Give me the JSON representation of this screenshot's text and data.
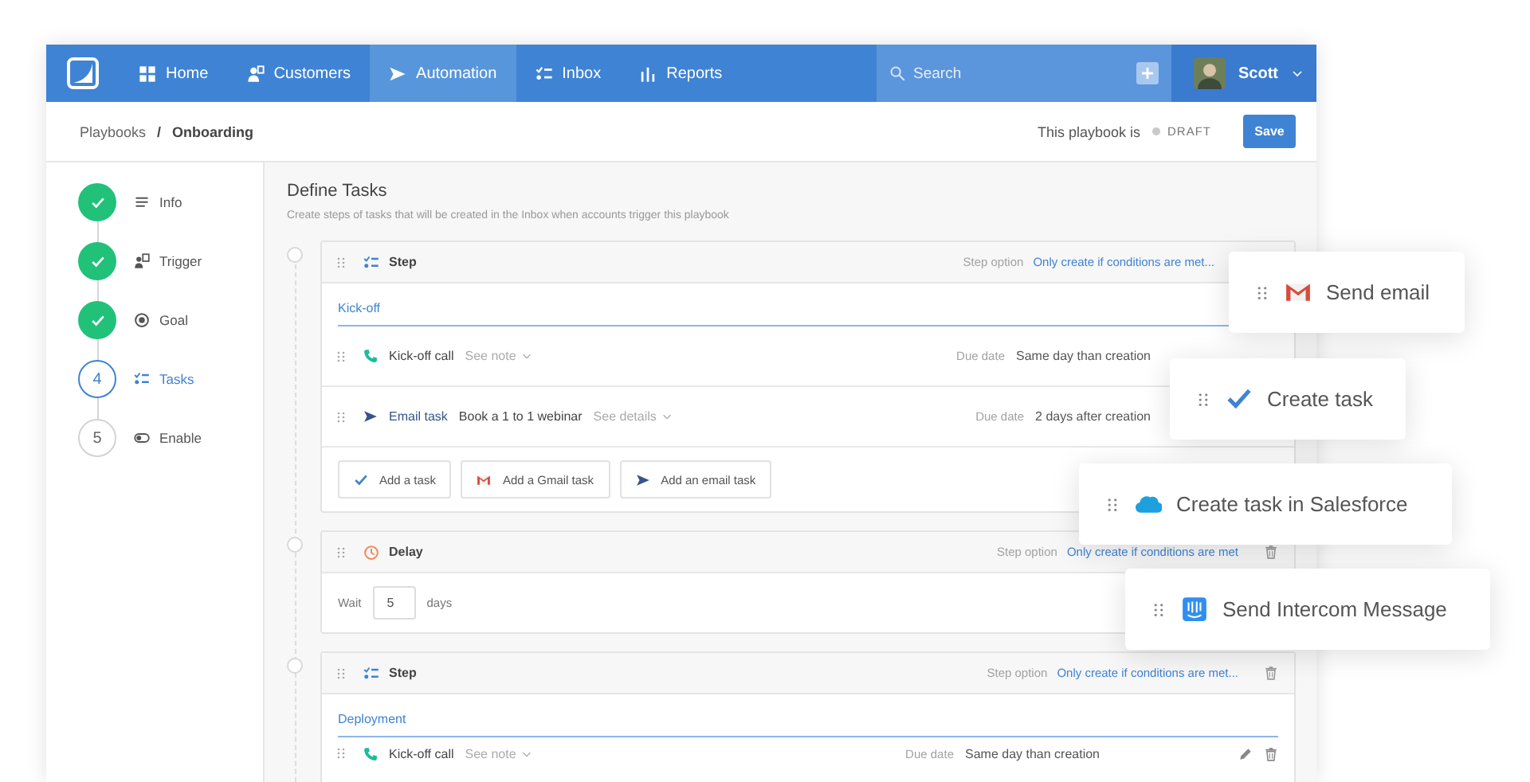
{
  "nav": {
    "items": [
      {
        "label": "Home",
        "selected": false
      },
      {
        "label": "Customers",
        "selected": false
      },
      {
        "label": "Automation",
        "selected": true
      },
      {
        "label": "Inbox",
        "selected": false
      },
      {
        "label": "Reports",
        "selected": false
      }
    ],
    "search": {
      "placeholder": "Search"
    },
    "user": {
      "name": "Scott"
    }
  },
  "breadcrumb": {
    "items": [
      "Playbooks",
      "Onboarding"
    ],
    "separator": "/"
  },
  "status": {
    "label": "This playbook is",
    "value": "DRAFT"
  },
  "save": "Save",
  "wizard": [
    {
      "label": "Info",
      "completed": true,
      "selected": false
    },
    {
      "label": "Trigger",
      "completed": true,
      "selected": false
    },
    {
      "label": "Goal",
      "completed": true,
      "selected": false
    },
    {
      "label": "Tasks",
      "completed": false,
      "selected": true,
      "number": "4"
    },
    {
      "label": "Enable",
      "completed": false,
      "selected": false,
      "number": "5"
    }
  ],
  "title": "Define Tasks",
  "subtitle": "Create steps of tasks that will be created in the Inbox when accounts trigger this playbook",
  "blocks": [
    {
      "kind": "step",
      "title": "Step",
      "option_label": "Step option",
      "option": "Only create if conditions are met...",
      "name": "Kick-off",
      "tasks": [
        {
          "kind": "call",
          "title": "Kick-off call",
          "toggle": "See note",
          "due_label": "Due date",
          "due": "Same day than creation",
          "editable": false
        },
        {
          "kind": "email",
          "title": "Email task",
          "subject": "Book a 1 to 1 webinar",
          "toggle": "See details",
          "due_label": "Due date",
          "due": "2 days after creation",
          "editable": false
        }
      ],
      "add_buttons": [
        {
          "kind": "task",
          "label": "Add a task"
        },
        {
          "kind": "gmail",
          "label": "Add a Gmail task"
        },
        {
          "kind": "email",
          "label": "Add an email task"
        }
      ]
    },
    {
      "kind": "delay",
      "title": "Delay",
      "option_label": "Step option",
      "option": "Only create if conditions are met",
      "wait_label": "Wait",
      "wait_value": "5",
      "wait_unit": "days",
      "deletable": true
    },
    {
      "kind": "step",
      "title": "Step",
      "option_label": "Step option",
      "option": "Only create if conditions are met...",
      "name": "Deployment",
      "deletable": true,
      "tasks": [
        {
          "kind": "call",
          "title": "Kick-off call",
          "toggle": "See note",
          "due_label": "Due date",
          "due": "Same day than creation",
          "editable": true
        }
      ]
    }
  ],
  "actions": [
    {
      "kind": "gmail",
      "label": "Send email"
    },
    {
      "kind": "task",
      "label": "Create task"
    },
    {
      "kind": "salesforce",
      "label": "Create task in Salesforce"
    },
    {
      "kind": "intercom",
      "label": "Send Intercom Message"
    }
  ]
}
